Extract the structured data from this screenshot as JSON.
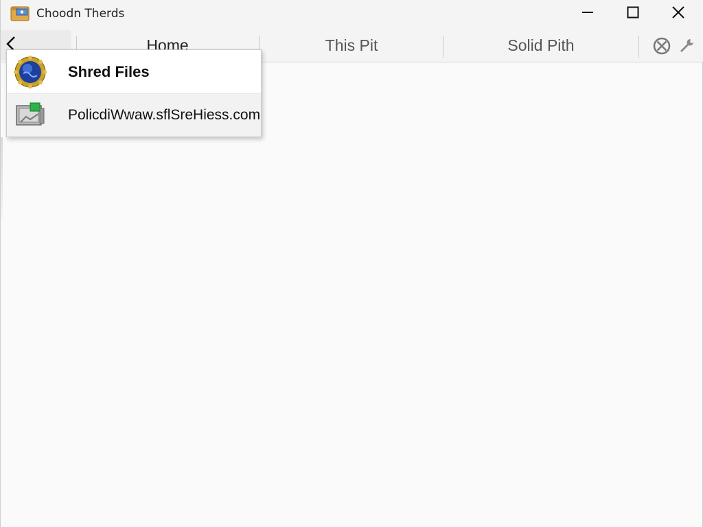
{
  "window": {
    "title": "Choodn Therds",
    "icons": {
      "app": "folder-icon",
      "minimize": "minimize-icon",
      "maximize": "maximize-icon",
      "close": "close-icon"
    }
  },
  "navbar": {
    "back_icon": "chevron-left-icon",
    "tabs": [
      {
        "label": "Home"
      },
      {
        "label": "This Pit"
      },
      {
        "label": "Solid Pith"
      }
    ],
    "tools": [
      "blocked-circle-icon",
      "wrench-icon"
    ]
  },
  "menu": {
    "items": [
      {
        "label": "Shred Files",
        "icon": "globe-gear-icon"
      },
      {
        "label": "PolicdiWwaw.sflSreHiess.com",
        "icon": "network-drive-icon"
      }
    ]
  },
  "colors": {
    "window_bg": "#fafafa",
    "titlebar_bg": "#f4f4f4",
    "menu_border": "#c7c7c7",
    "highlight_row": "#f2f2f2"
  }
}
